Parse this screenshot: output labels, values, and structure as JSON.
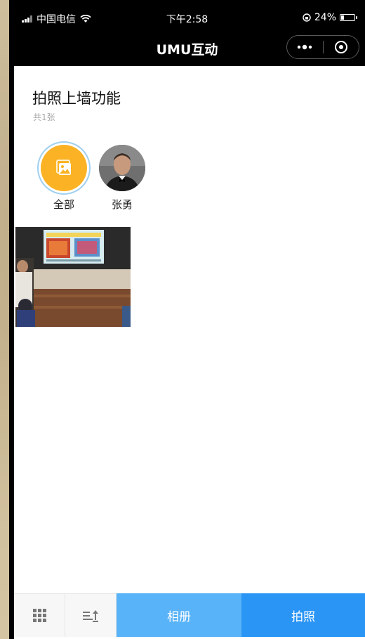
{
  "status_bar": {
    "carrier": "中国电信",
    "time": "下午2:58",
    "battery_text": "24%",
    "battery_level": 0.24
  },
  "nav": {
    "title": "UMU互动",
    "more_icon": "more-dots-icon",
    "close_icon": "target-circle-icon"
  },
  "page": {
    "title": "拍照上墙功能",
    "count": "共1张"
  },
  "filters": [
    {
      "label": "全部",
      "icon": "gallery-icon",
      "selected": true
    },
    {
      "label": "张勇",
      "icon": "user-avatar"
    }
  ],
  "photos": [
    {
      "kind": "classroom-projector-photo"
    }
  ],
  "bottom_bar": {
    "grid_icon": "grid-icon",
    "sort_icon": "sort-upload-icon",
    "album_label": "相册",
    "shoot_label": "拍照",
    "colors": {
      "album": "#59b3f8",
      "shoot": "#2a95f5"
    }
  }
}
